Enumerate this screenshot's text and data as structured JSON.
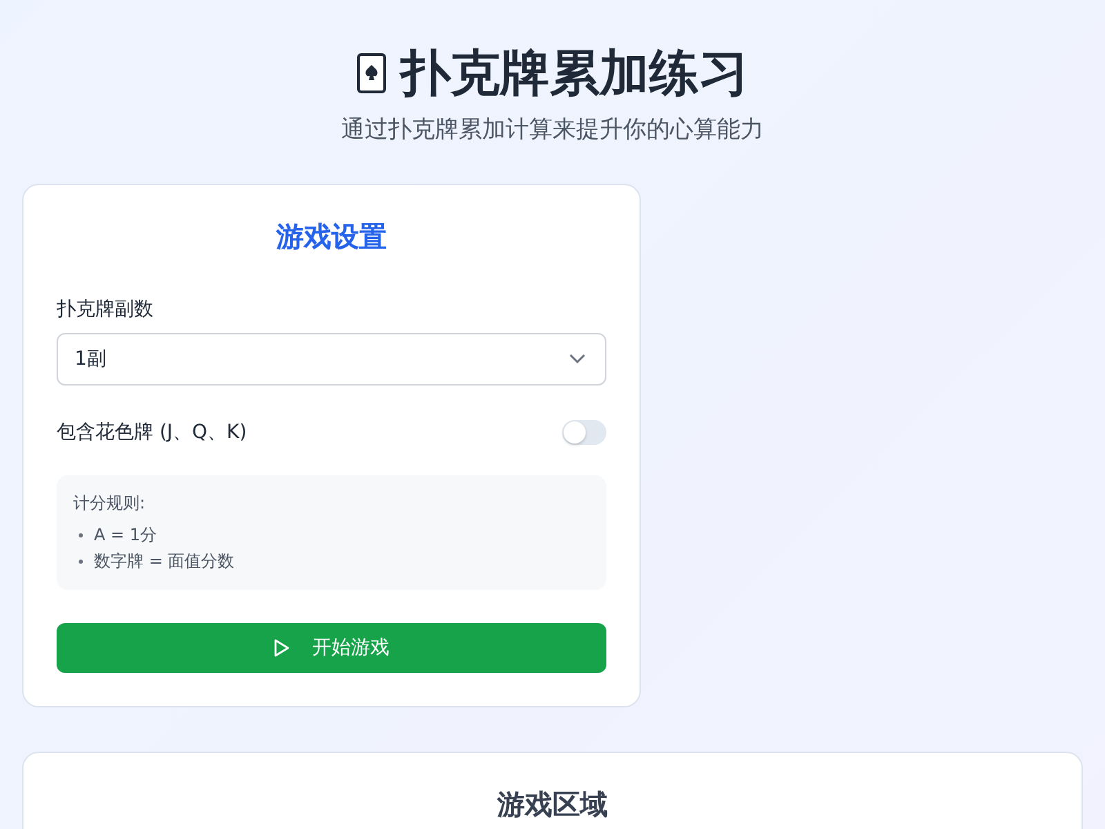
{
  "header": {
    "title": "扑克牌累加练习",
    "subtitle": "通过扑克牌累加计算来提升你的心算能力"
  },
  "settings": {
    "title": "游戏设置",
    "deck_label": "扑克牌副数",
    "deck_value": "1副",
    "face_cards_label": "包含花色牌 (J、Q、K)",
    "face_cards_on": false,
    "rules_title": "计分规则:",
    "rules": [
      "A = 1分",
      "数字牌 = 面值分数"
    ],
    "start_button": "开始游戏"
  },
  "game_area": {
    "title": "游戏区域"
  }
}
